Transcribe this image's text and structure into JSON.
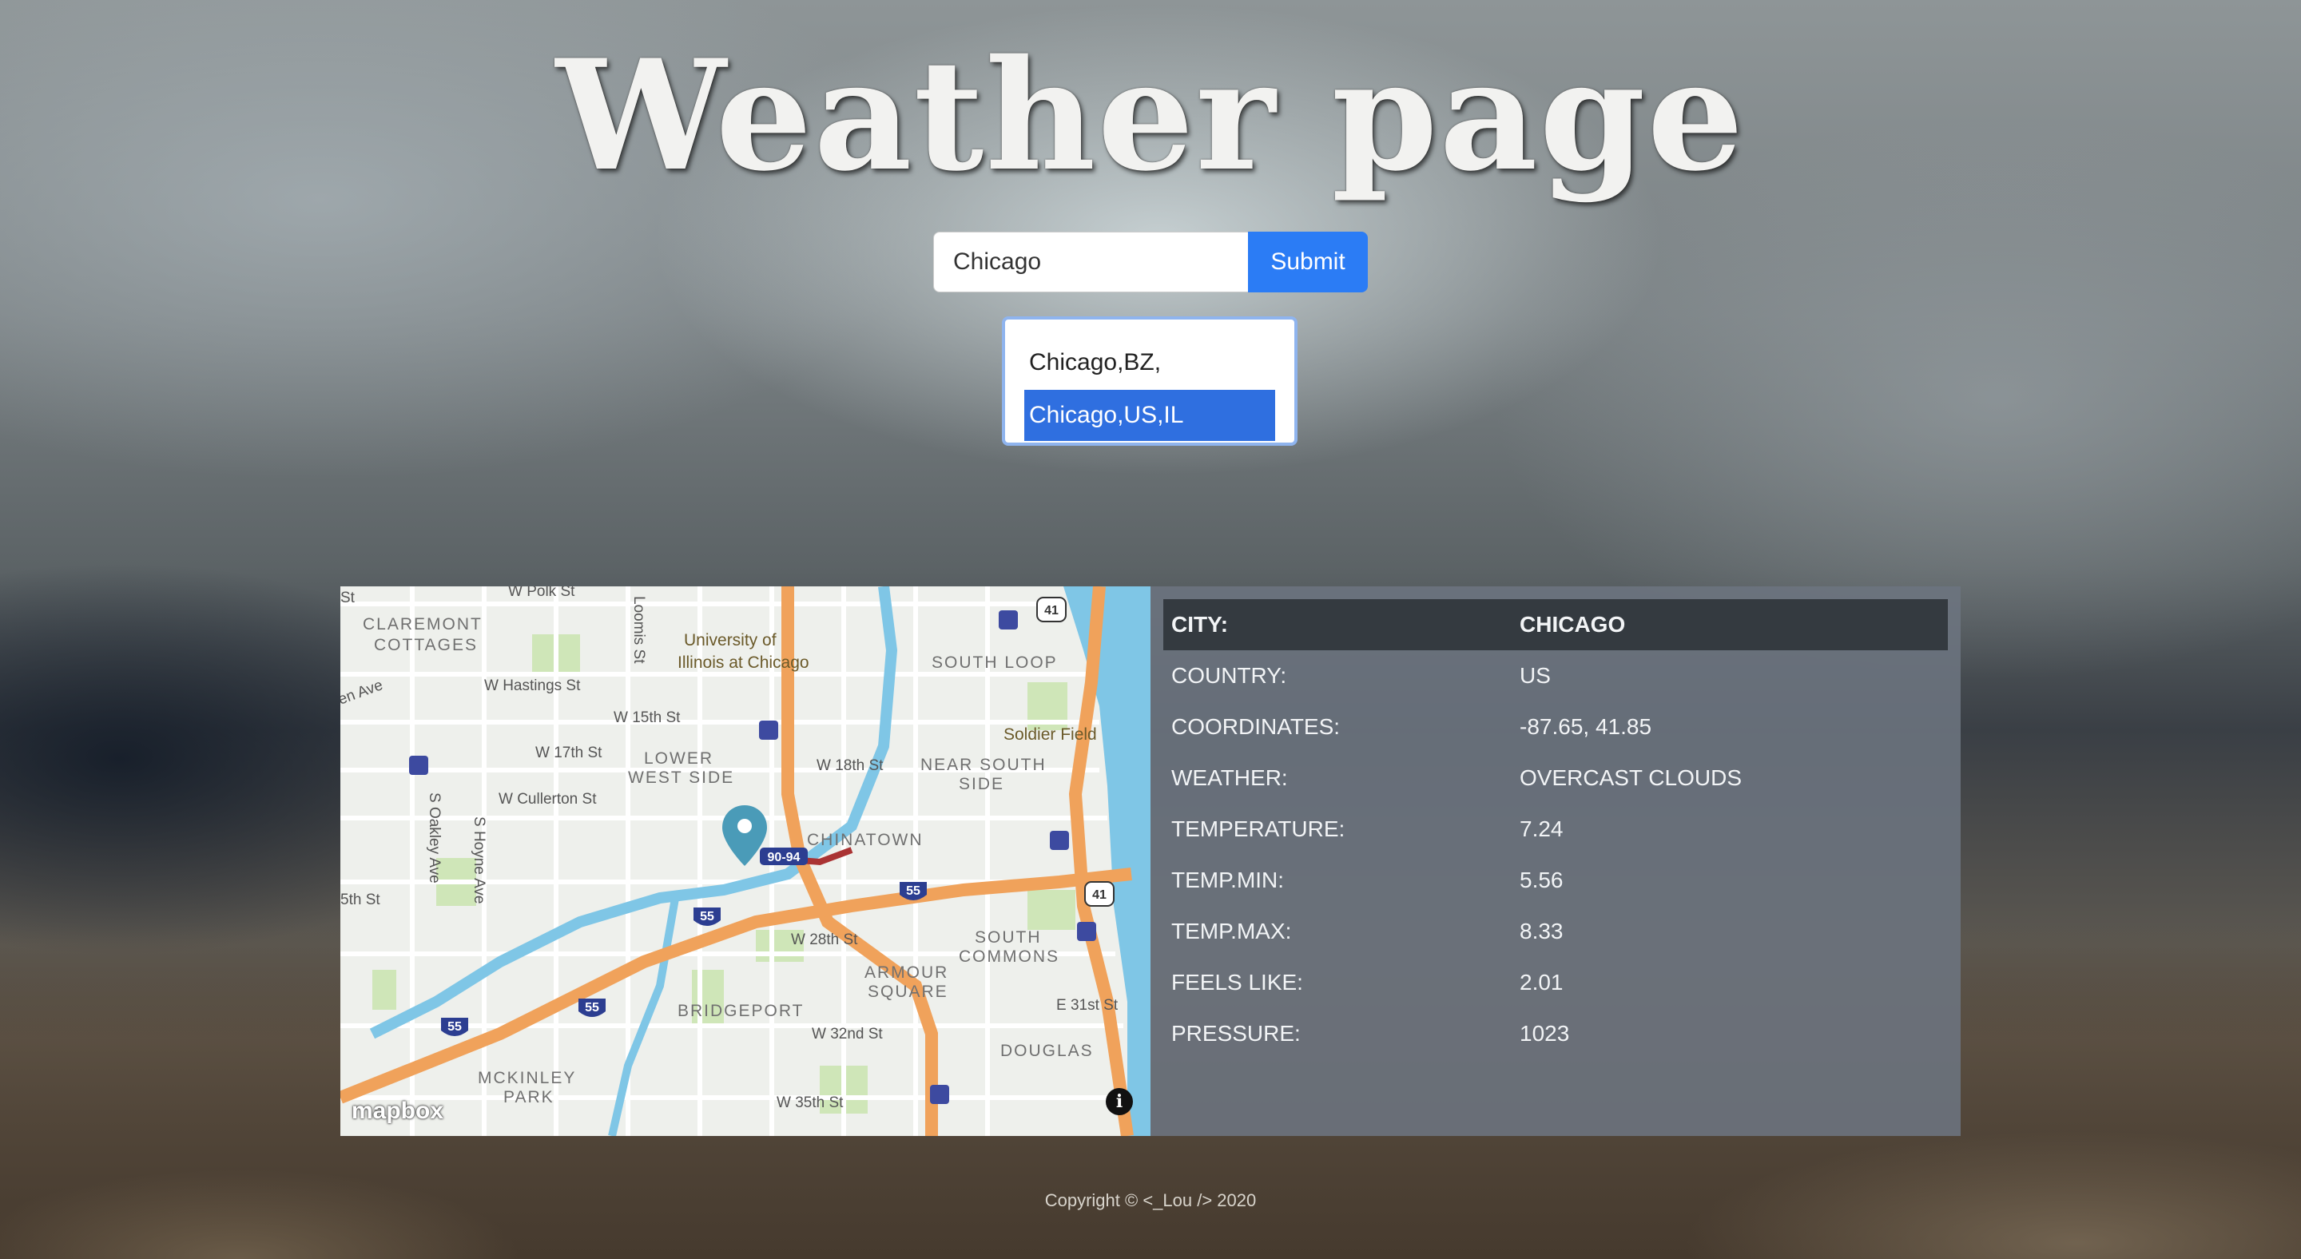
{
  "page": {
    "title": "Weather page"
  },
  "search": {
    "value": "Chicago",
    "submit_label": "Submit"
  },
  "suggestions": [
    "Chicago,BZ,",
    "Chicago,US,IL"
  ],
  "map": {
    "attribution": "mapbox",
    "info_icon": "info-icon",
    "marker_icon": "map-pin-icon",
    "labels": [
      "W Polk St",
      "CLAREMONT",
      "COTTAGES",
      "Loomis St",
      "University of",
      "Illinois at Chicago",
      "SOUTH LOOP",
      "41",
      "W Hastings St",
      "en Ave",
      "W 15th St",
      "Soldier Field",
      "W 17th St",
      "LOWER",
      "WEST SIDE",
      "W 18th St",
      "NEAR SOUTH",
      "SIDE",
      "W Cullerton St",
      "S Oakley Ave",
      "S Hoyne Ave",
      "90-94",
      "CHINATOWN",
      "55",
      "5th St",
      "W 28th St",
      "SOUTH",
      "COMMONS",
      "ARMOUR",
      "SQUARE",
      "BRIDGEPORT",
      "E 31st St",
      "W 32nd St",
      "DOUGLAS",
      "MCKINLEY",
      "PARK",
      "W 35th St",
      "St"
    ]
  },
  "weather": {
    "rows": [
      {
        "label": "City:",
        "value": "Chicago"
      },
      {
        "label": "Country:",
        "value": "US"
      },
      {
        "label": "Coordinates:",
        "value": "-87.65, 41.85"
      },
      {
        "label": "Weather:",
        "value": "overcast clouds"
      },
      {
        "label": "Temperature:",
        "value": "7.24"
      },
      {
        "label": "Temp.min:",
        "value": "5.56"
      },
      {
        "label": "Temp.max:",
        "value": "8.33"
      },
      {
        "label": "Feels like:",
        "value": "2.01"
      },
      {
        "label": "Pressure:",
        "value": "1023"
      }
    ]
  },
  "footer": {
    "copyright": "Copyright © <_Lou /> 2020"
  }
}
